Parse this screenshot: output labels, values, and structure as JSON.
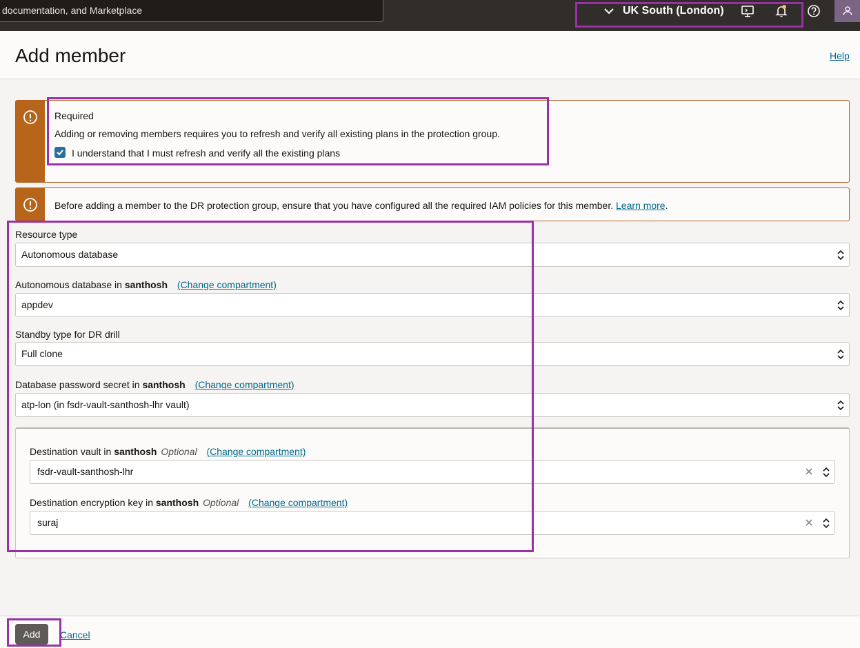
{
  "topbar": {
    "search_text": "documentation, and Marketplace",
    "region_label": "UK South (London)"
  },
  "page": {
    "title": "Add member",
    "help_label": "Help"
  },
  "notices": {
    "required": {
      "title": "Required",
      "message": "Adding or removing members requires you to refresh and verify all existing plans in the protection group.",
      "checkbox_label": "I understand that I must refresh and verify all the existing plans",
      "checked": true
    },
    "iam": {
      "message": "Before adding a member to the DR protection group, ensure that you have configured all the required IAM policies for this member.",
      "link": "Learn more",
      "trailing": "."
    }
  },
  "form": {
    "resource_type": {
      "label": "Resource type",
      "value": "Autonomous database"
    },
    "autonomous_db": {
      "label": "Autonomous database in",
      "compartment": "santhosh",
      "change_link": "(Change compartment)",
      "value": "appdev"
    },
    "standby_type": {
      "label": "Standby type for DR drill",
      "value": "Full clone"
    },
    "password_secret": {
      "label": "Database password secret in",
      "compartment": "santhosh",
      "change_link": "(Change compartment)",
      "value": "atp-lon (in fsdr-vault-santhosh-lhr vault)"
    },
    "dest_vault": {
      "label": "Destination vault in",
      "compartment": "santhosh",
      "optional": "Optional",
      "change_link": "(Change compartment)",
      "value": "fsdr-vault-santhosh-lhr"
    },
    "dest_key": {
      "label": "Destination encryption key in",
      "compartment": "santhosh",
      "optional": "Optional",
      "change_link": "(Change compartment)",
      "value": "suraj"
    }
  },
  "footer": {
    "add_label": "Add",
    "cancel_label": "Cancel"
  },
  "colors": {
    "topbar": "#312d2a",
    "warning": "#b8651c",
    "link": "#00688c",
    "highlight": "#9b2fa8"
  }
}
